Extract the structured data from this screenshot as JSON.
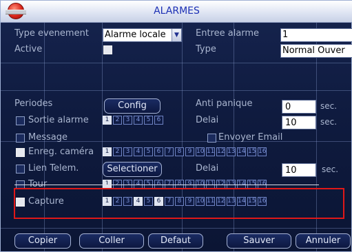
{
  "window": {
    "title": "ALARMES",
    "accent": "#1b2fb4",
    "highlight_color": "#e01818"
  },
  "fields": {
    "event_type_label": "Type evenement",
    "event_type_value": "Alarme locale",
    "alarm_input_label": "Entree alarme",
    "alarm_input_value": "1",
    "active_label": "Active",
    "type_label": "Type",
    "type_value": "Normal Ouver",
    "periods_label": "Periodes",
    "config_button": "Config",
    "anti_panic_label": "Anti panique",
    "anti_panic_value": "0",
    "sec_unit": "sec.",
    "alarm_out_label": "Sortie alarme",
    "delay_label": "Delai",
    "delay_value_1": "10",
    "message_label": "Message",
    "send_email_label": "Envoyer Email",
    "record_camera_label": "Enreg. caméra",
    "ptz_link_label": "Lien Telem.",
    "select_button": "Selectioner",
    "delay_value_2": "10",
    "tour_label": "Tour",
    "capture_label": "Capture"
  },
  "channels_6": [
    "1",
    "2",
    "3",
    "4",
    "5",
    "6"
  ],
  "channels_16": [
    "1",
    "2",
    "3",
    "4",
    "5",
    "6",
    "7",
    "8",
    "9",
    "10",
    "11",
    "12",
    "13",
    "14",
    "15",
    "16"
  ],
  "buttons": {
    "copy": "Copier",
    "paste": "Coller",
    "default": "Defaut",
    "save": "Sauver",
    "cancel": "Annuler"
  },
  "states": {
    "active_checked": true,
    "record_camera_checked": true,
    "capture_checked": true,
    "alarm_out_selected": [
      1
    ],
    "record_selected": [
      1
    ],
    "capture_selected": [
      1,
      4,
      6
    ]
  },
  "icons": {
    "logo": "dvr-logo-icon",
    "dropdown": "chevron-down-icon"
  }
}
